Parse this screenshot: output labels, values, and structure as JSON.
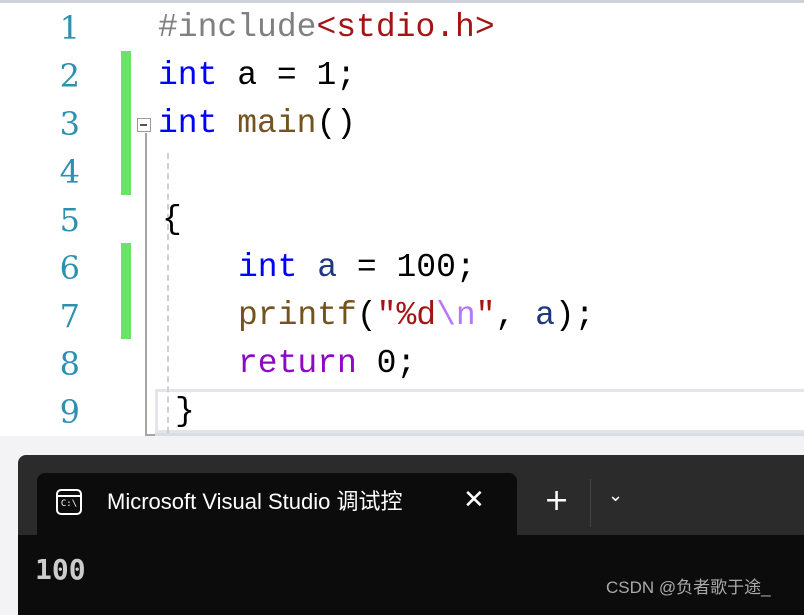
{
  "editor": {
    "line_numbers": [
      "1",
      "2",
      "3",
      "4",
      "5",
      "6",
      "7",
      "8",
      "9"
    ],
    "lines": {
      "l1": {
        "directive": "#include",
        "header": "<stdio.h>"
      },
      "l2": {
        "kw": "int",
        "rest": " a = 1;"
      },
      "l3": {
        "kw": "int",
        "fn": "main",
        "rest": "()"
      },
      "l5": {
        "text": "{"
      },
      "l6": {
        "kw": "int",
        "var": "a",
        "rest": " = 100;"
      },
      "l7": {
        "fn": "printf",
        "p1": "(",
        "s1": "\"%d",
        "esc": "\\n",
        "s2": "\"",
        "rest": ", ",
        "var": "a",
        "end": ");"
      },
      "l8": {
        "kw": "return",
        "rest": " 0;"
      },
      "l9": {
        "text": "}"
      }
    }
  },
  "terminal": {
    "tab_title": "Microsoft Visual Studio 调试控",
    "tab_icon_text": "C:\\",
    "close": "✕",
    "new_tab": "+",
    "dropdown": "⌄",
    "output": "100",
    "watermark": "CSDN @负者歌于途_"
  }
}
